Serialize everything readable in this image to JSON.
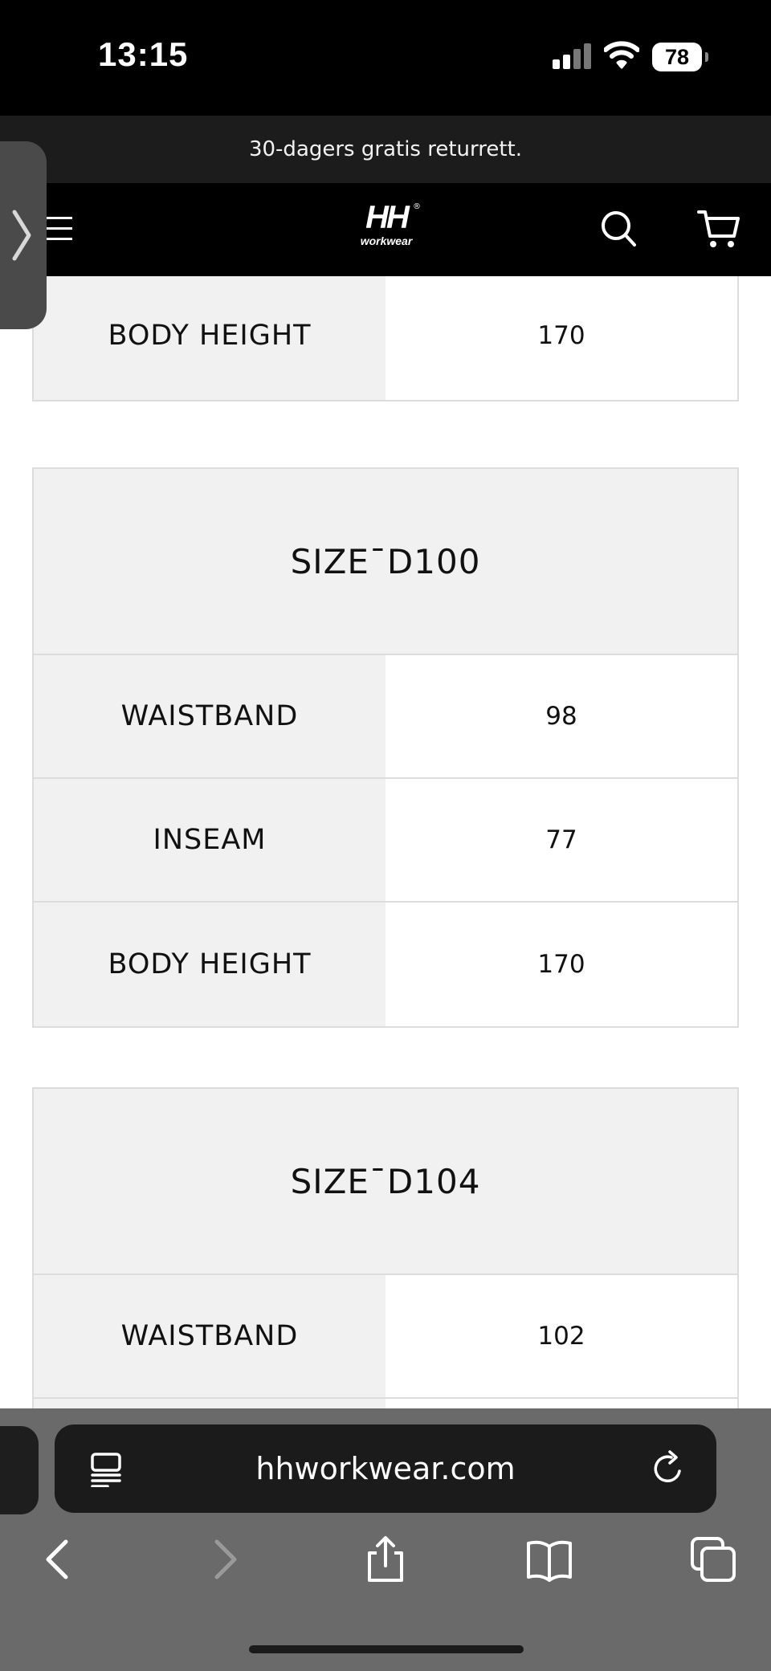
{
  "status_bar": {
    "time": "13:15",
    "battery": "78"
  },
  "promo": {
    "text": "30-dagers gratis returrett."
  },
  "header": {
    "logo_main": "HH",
    "logo_sub": "workwear",
    "logo_reg": "®"
  },
  "tables": [
    {
      "rows": [
        {
          "label": "BODY HEIGHT",
          "value": "170"
        }
      ]
    },
    {
      "title": "SIZE¯D100",
      "rows": [
        {
          "label": "WAISTBAND",
          "value": "98"
        },
        {
          "label": "INSEAM",
          "value": "77"
        },
        {
          "label": "BODY HEIGHT",
          "value": "170"
        }
      ]
    },
    {
      "title": "SIZE¯D104",
      "rows": [
        {
          "label": "WAISTBAND",
          "value": "102"
        }
      ]
    }
  ],
  "browser": {
    "url": "hhworkwear.com"
  },
  "colors": {
    "header_bg": "#000000",
    "promo_bg": "#1c1c1c",
    "label_cell_bg": "#f1f1f1",
    "browser_bg": "#6a6a6a"
  }
}
